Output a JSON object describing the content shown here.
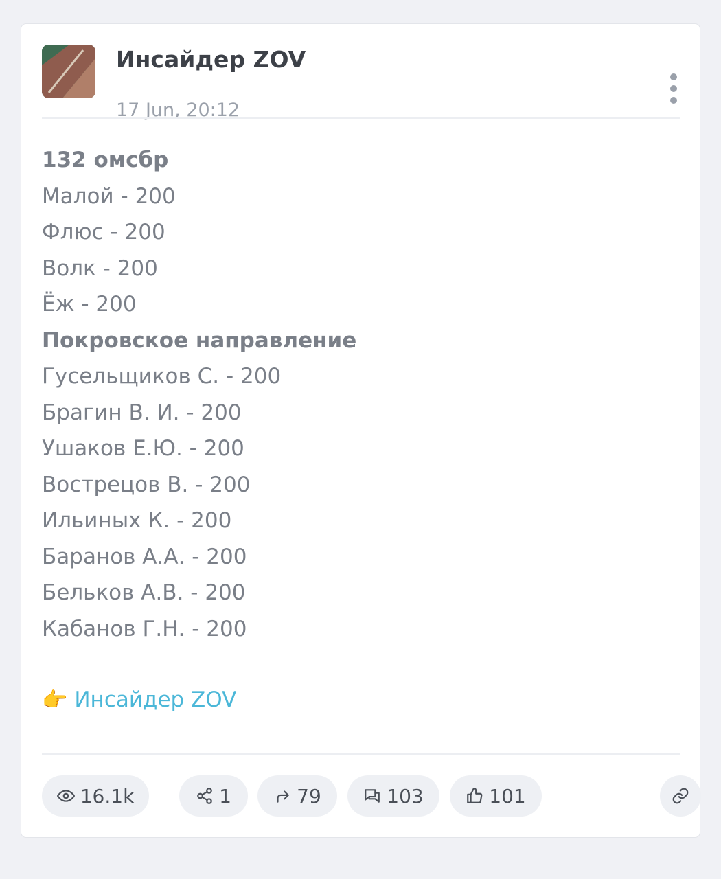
{
  "post": {
    "channel_name": "Инсайдер ZOV",
    "date": "17 Jun, 20:12",
    "lines": [
      {
        "text": "132 омсбр",
        "bold": true
      },
      {
        "text": "Малой - 200",
        "bold": false
      },
      {
        "text": "Флюс - 200",
        "bold": false
      },
      {
        "text": "Волк - 200",
        "bold": false
      },
      {
        "text": "Ёж - 200",
        "bold": false
      },
      {
        "text": "Покровское направление",
        "bold": true
      },
      {
        "text": "Гусельщиков С. - 200",
        "bold": false
      },
      {
        "text": "Брагин В. И. - 200",
        "bold": false
      },
      {
        "text": "Ушаков Е.Ю. - 200",
        "bold": false
      },
      {
        "text": "Вострецов В. - 200",
        "bold": false
      },
      {
        "text": "Ильиных К. - 200",
        "bold": false
      },
      {
        "text": "Баранов А.А. - 200",
        "bold": false
      },
      {
        "text": "Бельков А.В. - 200",
        "bold": false
      },
      {
        "text": "Кабанов Г.Н. - 200",
        "bold": false
      }
    ],
    "link": {
      "emoji": "👉",
      "text": "Инсайдер ZOV"
    }
  },
  "stats": {
    "views": "16.1k",
    "shares": "1",
    "forwards": "79",
    "comments": "103",
    "reactions": "101"
  },
  "icons": {
    "views": "eye-icon",
    "shares": "share-nodes-icon",
    "forwards": "forward-arrow-icon",
    "comments": "comments-icon",
    "reactions": "thumbs-up-icon",
    "copy_link": "link-icon",
    "menu": "more-vertical-icon"
  },
  "colors": {
    "background": "#f0f1f5",
    "card": "#ffffff",
    "text": "#7a7f88",
    "title": "#3d4148",
    "muted": "#9aa0aa",
    "link": "#4bb7d8",
    "pill": "#eef0f4"
  }
}
